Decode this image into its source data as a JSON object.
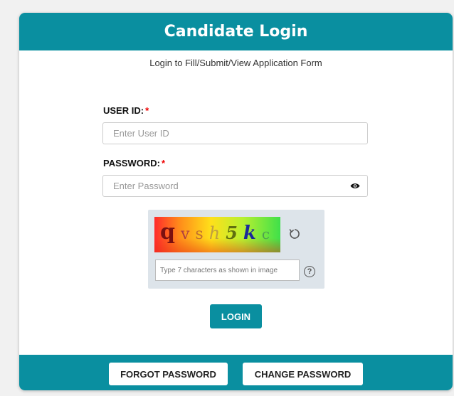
{
  "header": {
    "title": "Candidate Login"
  },
  "subtitle": "Login to Fill/Submit/View Application Form",
  "form": {
    "user_id": {
      "label": "USER ID:",
      "required_mark": "*",
      "placeholder": "Enter User ID",
      "value": ""
    },
    "password": {
      "label": "PASSWORD:",
      "required_mark": "*",
      "placeholder": "Enter Password",
      "value": ""
    }
  },
  "captcha": {
    "characters": [
      {
        "char": "q",
        "color": "#7a1010",
        "style": "normal",
        "weight": "bold"
      },
      {
        "char": "v",
        "color": "#b04040",
        "style": "normal",
        "weight": "normal"
      },
      {
        "char": "s",
        "color": "#c07030",
        "style": "normal",
        "weight": "normal"
      },
      {
        "char": "h",
        "color": "#c0a040",
        "style": "italic",
        "weight": "normal"
      },
      {
        "char": "5",
        "color": "#607010",
        "style": "italic",
        "weight": "bold"
      },
      {
        "char": "k",
        "color": "#1a2a9a",
        "style": "italic",
        "weight": "bold"
      },
      {
        "char": "c",
        "color": "#50a050",
        "style": "normal",
        "weight": "normal"
      }
    ],
    "input_placeholder": "Type 7 characters as shown in image",
    "refresh_icon": "refresh-icon",
    "help_icon": "question-circle-icon",
    "help_glyph": "?"
  },
  "buttons": {
    "login": "LOGIN",
    "forgot_password": "FORGOT PASSWORD",
    "change_password": "CHANGE PASSWORD"
  },
  "colors": {
    "accent": "#0a8fa0",
    "required": "#e00000"
  }
}
